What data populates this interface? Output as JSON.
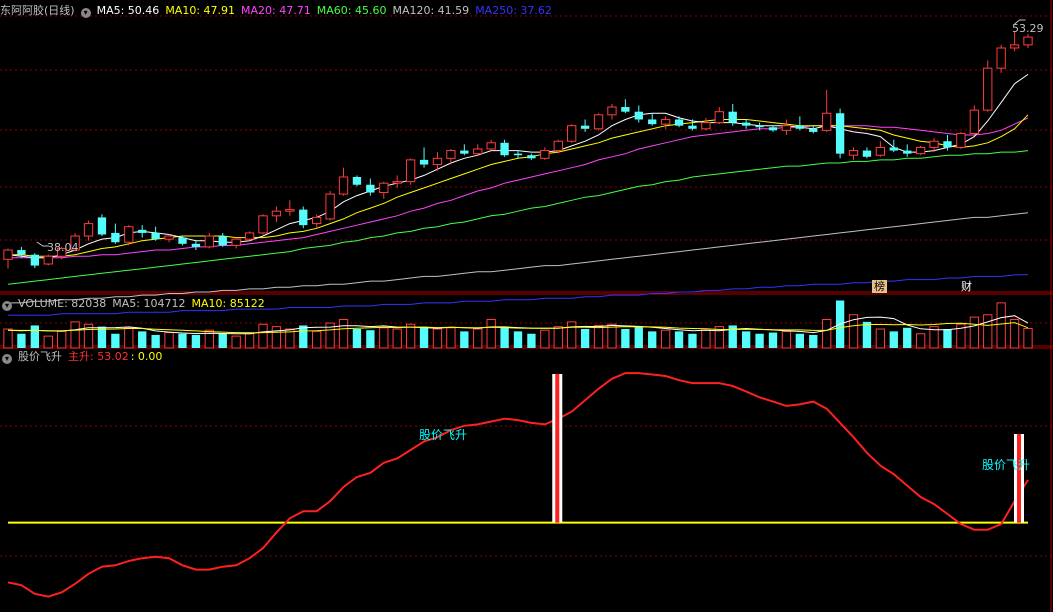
{
  "header": {
    "title": "东阿阿胶(日线)",
    "ma_labels": [
      {
        "name": "MA5",
        "text": "MA5: 50.46",
        "color": "#ffffff"
      },
      {
        "name": "MA10",
        "text": "MA10: 47.91",
        "color": "#ffff00"
      },
      {
        "name": "MA20",
        "text": "MA20: 47.71",
        "color": "#ff44ff"
      },
      {
        "name": "MA60",
        "text": "MA60: 45.60",
        "color": "#44ff44"
      },
      {
        "name": "MA120",
        "text": "MA120: 41.59",
        "color": "#c0c0c0"
      },
      {
        "name": "MA250",
        "text": "MA250: 37.62",
        "color": "#3333ff"
      }
    ]
  },
  "price_marks": {
    "high": "53.29",
    "low": "38.04"
  },
  "event_badges": {
    "bang": "榜",
    "cai": "财"
  },
  "volume_header": {
    "items": [
      {
        "text": "VOLUME: 82038",
        "color": "#c0c0c0"
      },
      {
        "text": "MA5: 104712",
        "color": "#c0c0c0"
      },
      {
        "text": "MA10: 85122",
        "color": "#ffff00"
      }
    ]
  },
  "indicator_header": {
    "name": "股价飞升",
    "line_label": "主升: 53.02",
    "zero_label": ": 0.00"
  },
  "signals": {
    "label1": "股价飞升",
    "label2": "股价飞升"
  },
  "colors": {
    "up": "#ff3c3c",
    "down": "#54fcfc",
    "grid": "#8a0000",
    "main_line": "#ff2020",
    "zero_line": "#ffff00"
  },
  "chart_data": {
    "type": "candlestick",
    "title": "东阿阿胶(日线)",
    "price_range": [
      37.4,
      54.0
    ],
    "candles": [
      [
        38.6,
        39.3,
        38.0,
        39.2
      ],
      [
        39.2,
        39.4,
        38.7,
        38.9
      ],
      [
        38.9,
        39.0,
        38.04,
        38.2
      ],
      [
        38.3,
        38.9,
        38.2,
        38.8
      ],
      [
        38.8,
        39.4,
        38.6,
        39.3
      ],
      [
        39.2,
        40.3,
        39.1,
        40.1
      ],
      [
        40.1,
        41.1,
        39.8,
        40.9
      ],
      [
        41.3,
        41.5,
        40.1,
        40.2
      ],
      [
        40.3,
        40.9,
        39.6,
        39.7
      ],
      [
        39.7,
        40.8,
        39.5,
        40.7
      ],
      [
        40.5,
        40.8,
        40.0,
        40.3
      ],
      [
        40.3,
        40.7,
        39.8,
        39.9
      ],
      [
        39.9,
        40.2,
        39.7,
        40.1
      ],
      [
        40.0,
        40.1,
        39.5,
        39.6
      ],
      [
        39.6,
        39.8,
        39.2,
        39.4
      ],
      [
        39.4,
        40.3,
        39.3,
        40.1
      ],
      [
        40.1,
        40.3,
        39.4,
        39.5
      ],
      [
        39.5,
        40.0,
        39.3,
        39.9
      ],
      [
        39.9,
        40.4,
        39.8,
        40.3
      ],
      [
        40.3,
        41.5,
        40.2,
        41.4
      ],
      [
        41.4,
        42.0,
        41.0,
        41.7
      ],
      [
        41.7,
        42.4,
        41.4,
        41.8
      ],
      [
        41.8,
        42.0,
        40.6,
        40.8
      ],
      [
        40.9,
        41.5,
        40.6,
        41.3
      ],
      [
        41.2,
        43.0,
        41.1,
        42.8
      ],
      [
        42.8,
        44.5,
        42.7,
        43.9
      ],
      [
        43.9,
        44.0,
        43.3,
        43.4
      ],
      [
        43.4,
        43.8,
        42.7,
        42.9
      ],
      [
        42.9,
        43.6,
        42.5,
        43.5
      ],
      [
        43.5,
        44.0,
        43.2,
        43.6
      ],
      [
        43.6,
        45.1,
        43.4,
        45.0
      ],
      [
        45.0,
        45.8,
        44.5,
        44.7
      ],
      [
        44.7,
        45.5,
        44.3,
        45.1
      ],
      [
        45.1,
        45.7,
        44.7,
        45.6
      ],
      [
        45.6,
        46.0,
        45.3,
        45.4
      ],
      [
        45.4,
        46.0,
        45.3,
        45.7
      ],
      [
        45.7,
        46.3,
        45.6,
        46.1
      ],
      [
        46.1,
        46.3,
        45.2,
        45.3
      ],
      [
        45.4,
        45.6,
        45.1,
        45.3
      ],
      [
        45.3,
        45.4,
        45.0,
        45.1
      ],
      [
        45.1,
        45.8,
        45.0,
        45.6
      ],
      [
        45.6,
        46.3,
        45.4,
        46.2
      ],
      [
        46.2,
        47.3,
        46.1,
        47.2
      ],
      [
        47.2,
        47.6,
        46.8,
        47.0
      ],
      [
        47.0,
        48.0,
        46.9,
        47.9
      ],
      [
        47.9,
        48.6,
        47.6,
        48.4
      ],
      [
        48.4,
        48.9,
        48.0,
        48.1
      ],
      [
        48.1,
        48.5,
        47.4,
        47.6
      ],
      [
        47.6,
        48.0,
        47.2,
        47.3
      ],
      [
        47.3,
        47.8,
        47.0,
        47.6
      ],
      [
        47.6,
        47.8,
        47.1,
        47.2
      ],
      [
        47.2,
        47.6,
        46.9,
        47.0
      ],
      [
        47.0,
        47.7,
        46.9,
        47.4
      ],
      [
        47.4,
        48.4,
        47.3,
        48.1
      ],
      [
        48.1,
        48.6,
        47.2,
        47.4
      ],
      [
        47.4,
        47.6,
        47.0,
        47.2
      ],
      [
        47.2,
        47.4,
        46.9,
        47.1
      ],
      [
        47.1,
        47.2,
        46.8,
        46.9
      ],
      [
        46.9,
        47.6,
        46.6,
        47.2
      ],
      [
        47.2,
        47.8,
        46.9,
        47.0
      ],
      [
        47.0,
        47.2,
        46.7,
        46.8
      ],
      [
        46.9,
        49.5,
        46.8,
        48.0
      ],
      [
        48.0,
        48.3,
        45.1,
        45.4
      ],
      [
        45.3,
        45.8,
        45.0,
        45.6
      ],
      [
        45.6,
        45.8,
        45.1,
        45.2
      ],
      [
        45.3,
        46.2,
        45.2,
        45.8
      ],
      [
        45.8,
        46.3,
        45.5,
        45.6
      ],
      [
        45.6,
        46.0,
        45.2,
        45.4
      ],
      [
        45.4,
        45.9,
        45.3,
        45.8
      ],
      [
        45.8,
        46.4,
        45.5,
        46.2
      ],
      [
        46.2,
        46.6,
        45.6,
        45.8
      ],
      [
        45.8,
        46.8,
        45.7,
        46.7
      ],
      [
        46.7,
        48.5,
        46.6,
        48.2
      ],
      [
        48.2,
        51.4,
        48.1,
        50.9
      ],
      [
        50.9,
        52.4,
        50.6,
        52.2
      ],
      [
        52.2,
        53.29,
        52.0,
        52.4
      ],
      [
        52.4,
        53.1,
        52.2,
        52.9
      ]
    ],
    "ma5": [
      38.9,
      38.8,
      38.7,
      38.7,
      38.9,
      39.2,
      39.6,
      39.9,
      40.0,
      40.3,
      40.4,
      40.3,
      40.2,
      40.0,
      39.8,
      39.8,
      39.7,
      39.7,
      39.8,
      40.1,
      40.5,
      40.9,
      41.1,
      41.3,
      41.7,
      42.3,
      42.7,
      43.0,
      43.3,
      43.5,
      43.7,
      44.0,
      44.4,
      44.8,
      45.1,
      45.3,
      45.6,
      45.6,
      45.6,
      45.5,
      45.5,
      45.6,
      45.9,
      46.2,
      46.6,
      47.2,
      47.6,
      47.9,
      48.0,
      48.0,
      47.7,
      47.5,
      47.4,
      47.4,
      47.4,
      47.3,
      47.2,
      47.2,
      47.2,
      47.1,
      47.0,
      47.2,
      47.0,
      46.8,
      46.7,
      46.5,
      45.8,
      45.5,
      45.5,
      45.6,
      45.8,
      46.0,
      46.5,
      47.5,
      48.7,
      49.9,
      50.5
    ],
    "ma10": [
      38.9,
      38.9,
      38.8,
      38.8,
      38.8,
      38.9,
      39.1,
      39.3,
      39.4,
      39.6,
      39.8,
      39.9,
      40.0,
      40.1,
      40.1,
      40.1,
      40.1,
      40.0,
      40.0,
      40.0,
      40.1,
      40.3,
      40.4,
      40.6,
      40.9,
      41.2,
      41.6,
      41.9,
      42.2,
      42.6,
      42.9,
      43.2,
      43.5,
      43.8,
      44.1,
      44.4,
      44.7,
      44.9,
      45.1,
      45.2,
      45.4,
      45.5,
      45.7,
      45.9,
      46.1,
      46.4,
      46.6,
      46.8,
      47.0,
      47.2,
      47.3,
      47.4,
      47.5,
      47.6,
      47.6,
      47.6,
      47.5,
      47.4,
      47.3,
      47.2,
      47.2,
      47.2,
      47.2,
      47.1,
      47.0,
      46.9,
      46.6,
      46.4,
      46.2,
      46.1,
      45.9,
      45.8,
      45.9,
      46.1,
      46.5,
      47.0,
      47.9
    ],
    "ma20": [
      38.7,
      38.7,
      38.7,
      38.7,
      38.7,
      38.8,
      38.8,
      38.9,
      38.9,
      39.0,
      39.1,
      39.2,
      39.2,
      39.3,
      39.4,
      39.4,
      39.5,
      39.5,
      39.6,
      39.7,
      39.8,
      39.9,
      40.0,
      40.2,
      40.4,
      40.6,
      40.8,
      41.0,
      41.2,
      41.4,
      41.7,
      41.9,
      42.2,
      42.4,
      42.7,
      43.0,
      43.2,
      43.5,
      43.7,
      43.9,
      44.1,
      44.3,
      44.5,
      44.7,
      45.0,
      45.2,
      45.4,
      45.7,
      45.9,
      46.1,
      46.3,
      46.5,
      46.6,
      46.7,
      46.8,
      46.9,
      47.0,
      47.0,
      47.1,
      47.1,
      47.2,
      47.2,
      47.2,
      47.2,
      47.2,
      47.1,
      47.1,
      47.0,
      46.9,
      46.8,
      46.7,
      46.6,
      46.6,
      46.7,
      46.9,
      47.3,
      47.7
    ],
    "ma60": [
      37.0,
      37.1,
      37.2,
      37.3,
      37.4,
      37.5,
      37.6,
      37.7,
      37.8,
      37.9,
      38.0,
      38.1,
      38.2,
      38.3,
      38.4,
      38.5,
      38.6,
      38.7,
      38.8,
      38.9,
      39.0,
      39.1,
      39.3,
      39.4,
      39.5,
      39.7,
      39.8,
      40.0,
      40.1,
      40.3,
      40.4,
      40.6,
      40.7,
      40.9,
      41.0,
      41.2,
      41.4,
      41.5,
      41.7,
      41.9,
      42.0,
      42.2,
      42.4,
      42.6,
      42.7,
      42.9,
      43.1,
      43.3,
      43.4,
      43.6,
      43.7,
      43.9,
      44.0,
      44.1,
      44.2,
      44.3,
      44.4,
      44.5,
      44.6,
      44.6,
      44.7,
      44.8,
      44.8,
      44.9,
      44.9,
      45.0,
      45.0,
      45.1,
      45.1,
      45.2,
      45.3,
      45.3,
      45.4,
      45.4,
      45.5,
      45.5,
      45.6
    ],
    "ma120": [
      35.8,
      35.8,
      35.9,
      35.9,
      36.0,
      36.0,
      36.1,
      36.1,
      36.2,
      36.2,
      36.3,
      36.3,
      36.4,
      36.4,
      36.5,
      36.5,
      36.6,
      36.6,
      36.7,
      36.7,
      36.8,
      36.8,
      36.9,
      36.9,
      37.0,
      37.0,
      37.1,
      37.2,
      37.2,
      37.3,
      37.4,
      37.5,
      37.5,
      37.6,
      37.7,
      37.8,
      37.8,
      37.9,
      38.0,
      38.1,
      38.2,
      38.2,
      38.3,
      38.4,
      38.5,
      38.6,
      38.7,
      38.8,
      38.9,
      39.0,
      39.1,
      39.2,
      39.3,
      39.4,
      39.5,
      39.6,
      39.7,
      39.8,
      39.9,
      40.0,
      40.1,
      40.2,
      40.3,
      40.4,
      40.5,
      40.6,
      40.7,
      40.8,
      40.9,
      41.0,
      41.1,
      41.2,
      41.3,
      41.3,
      41.4,
      41.5,
      41.6
    ],
    "ma250": [
      35.0,
      35.0,
      35.0,
      35.0,
      35.1,
      35.1,
      35.1,
      35.1,
      35.1,
      35.2,
      35.2,
      35.2,
      35.2,
      35.3,
      35.3,
      35.3,
      35.3,
      35.4,
      35.4,
      35.4,
      35.4,
      35.5,
      35.5,
      35.5,
      35.5,
      35.6,
      35.6,
      35.6,
      35.7,
      35.7,
      35.7,
      35.8,
      35.8,
      35.8,
      35.9,
      35.9,
      35.9,
      36.0,
      36.0,
      36.0,
      36.1,
      36.1,
      36.1,
      36.2,
      36.2,
      36.3,
      36.3,
      36.3,
      36.4,
      36.4,
      36.5,
      36.5,
      36.6,
      36.6,
      36.7,
      36.7,
      36.8,
      36.8,
      36.9,
      36.9,
      37.0,
      37.0,
      37.0,
      37.1,
      37.1,
      37.2,
      37.2,
      37.3,
      37.3,
      37.3,
      37.4,
      37.4,
      37.5,
      37.5,
      37.5,
      37.6,
      37.62
    ],
    "volume_range": [
      0,
      160000
    ],
    "volume": [
      80000,
      60000,
      95000,
      50000,
      70000,
      110000,
      100000,
      90000,
      60000,
      85000,
      70000,
      55000,
      65000,
      60000,
      55000,
      75000,
      60000,
      50000,
      60000,
      100000,
      90000,
      80000,
      95000,
      70000,
      105000,
      120000,
      80000,
      75000,
      85000,
      80000,
      100000,
      90000,
      80000,
      85000,
      70000,
      80000,
      120000,
      90000,
      70000,
      60000,
      75000,
      90000,
      110000,
      80000,
      95000,
      100000,
      80000,
      90000,
      70000,
      75000,
      70000,
      60000,
      80000,
      90000,
      95000,
      70000,
      60000,
      65000,
      70000,
      60000,
      55000,
      120000,
      200000,
      140000,
      110000,
      80000,
      70000,
      85000,
      60000,
      90000,
      80000,
      100000,
      130000,
      140000,
      190000,
      120000,
      82038
    ],
    "vol_ma5": [
      75000,
      73000,
      74000,
      72000,
      71000,
      77000,
      85000,
      85000,
      86000,
      89000,
      83000,
      72000,
      67000,
      63000,
      61000,
      62000,
      61000,
      60000,
      60000,
      68000,
      72000,
      76000,
      85000,
      87000,
      88000,
      94000,
      94000,
      90000,
      93000,
      88000,
      88000,
      86000,
      83000,
      87000,
      85000,
      83000,
      89000,
      89000,
      86000,
      84000,
      83000,
      83000,
      89000,
      91000,
      90000,
      95000,
      93000,
      91000,
      87000,
      82000,
      77000,
      73000,
      75000,
      73000,
      79000,
      82000,
      79000,
      76000,
      72000,
      70000,
      65000,
      74000,
      101000,
      119000,
      129000,
      130000,
      124000,
      97000,
      81000,
      77000,
      77000,
      83000,
      93000,
      110000,
      128000,
      136000,
      104712
    ],
    "vol_ma10": [
      75000,
      74000,
      74000,
      73000,
      73000,
      75000,
      78000,
      79000,
      80000,
      82000,
      82000,
      79000,
      77000,
      75000,
      72000,
      69000,
      67000,
      65000,
      64000,
      65000,
      66000,
      68000,
      72000,
      73000,
      76000,
      81000,
      83000,
      85000,
      87000,
      86000,
      88000,
      88000,
      86000,
      87000,
      86000,
      85000,
      87000,
      86000,
      84000,
      83000,
      83000,
      84000,
      87000,
      87000,
      86000,
      88000,
      90000,
      89000,
      89000,
      87000,
      84000,
      82000,
      81000,
      78000,
      78000,
      79000,
      78000,
      77000,
      76000,
      76000,
      74000,
      74000,
      86000,
      94000,
      99000,
      99000,
      98000,
      99000,
      97000,
      99000,
      103000,
      104000,
      100000,
      95000,
      101000,
      107000,
      85122
    ],
    "indicator_range": [
      -6,
      11
    ],
    "indicator": [
      -4.2,
      -4.4,
      -5.0,
      -5.2,
      -4.9,
      -4.3,
      -3.6,
      -3.1,
      -3.0,
      -2.7,
      -2.5,
      -2.4,
      -2.5,
      -3.0,
      -3.3,
      -3.3,
      -3.1,
      -3.0,
      -2.5,
      -1.8,
      -0.7,
      0.3,
      0.8,
      0.8,
      1.5,
      2.5,
      3.2,
      3.5,
      4.2,
      4.5,
      5.1,
      5.7,
      6.0,
      6.5,
      6.8,
      6.9,
      7.1,
      7.3,
      7.2,
      7.0,
      6.9,
      7.3,
      7.8,
      8.6,
      9.4,
      10.1,
      10.5,
      10.5,
      10.4,
      10.3,
      10.0,
      9.8,
      9.8,
      9.8,
      9.6,
      9.2,
      8.8,
      8.5,
      8.2,
      8.3,
      8.5,
      8.0,
      7.0,
      6.0,
      4.9,
      4.0,
      3.4,
      2.6,
      1.8,
      1.3,
      0.6,
      -0.1,
      -0.5,
      -0.5,
      -0.1,
      1.5,
      3.0
    ],
    "signal_indices": [
      41,
      76
    ]
  }
}
